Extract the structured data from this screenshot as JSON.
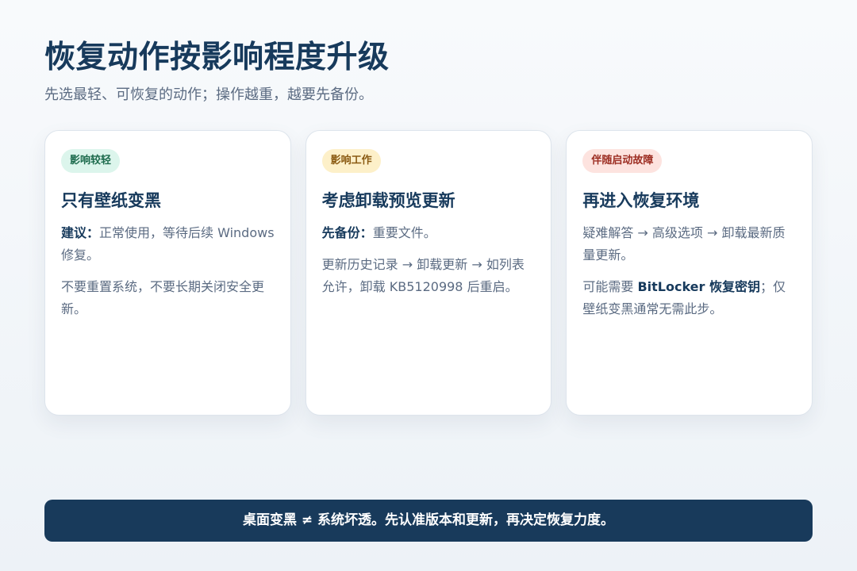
{
  "header": {
    "title": "恢复动作按影响程度升级",
    "subtitle": "先选最轻、可恢复的动作；操作越重，越要先备份。"
  },
  "colors": {
    "title": "#173a5c",
    "body_text": "#5b6b82",
    "banner_bg": "#183a5b",
    "badge_green_bg": "#dcf5ec",
    "badge_yellow_bg": "#fdf0c9",
    "badge_red_bg": "#fde3df"
  },
  "cards": [
    {
      "badge": "影响较轻",
      "title": "只有壁纸变黑",
      "p1_label": "建议：",
      "p1_text": "正常使用，等待后续 Windows 修复。",
      "p2_text": "不要重置系统，不要长期关闭安全更新。"
    },
    {
      "badge": "影响工作",
      "title": "考虑卸载预览更新",
      "p1_label": "先备份：",
      "p1_text": "重要文件。",
      "p2_text": "更新历史记录 → 卸载更新 → 如列表允许，卸载 KB5120998 后重启。"
    },
    {
      "badge": "伴随启动故障",
      "title": "再进入恢复环境",
      "p1_text": "疑难解答 → 高级选项 → 卸载最新质量更新。",
      "p2_before": "可能需要 ",
      "p2_strong": "BitLocker 恢复密钥",
      "p2_after": "；仅壁纸变黑通常无需此步。"
    }
  ],
  "footer": {
    "text": "桌面变黑 ≠ 系统坏透。先认准版本和更新，再决定恢复力度。"
  }
}
